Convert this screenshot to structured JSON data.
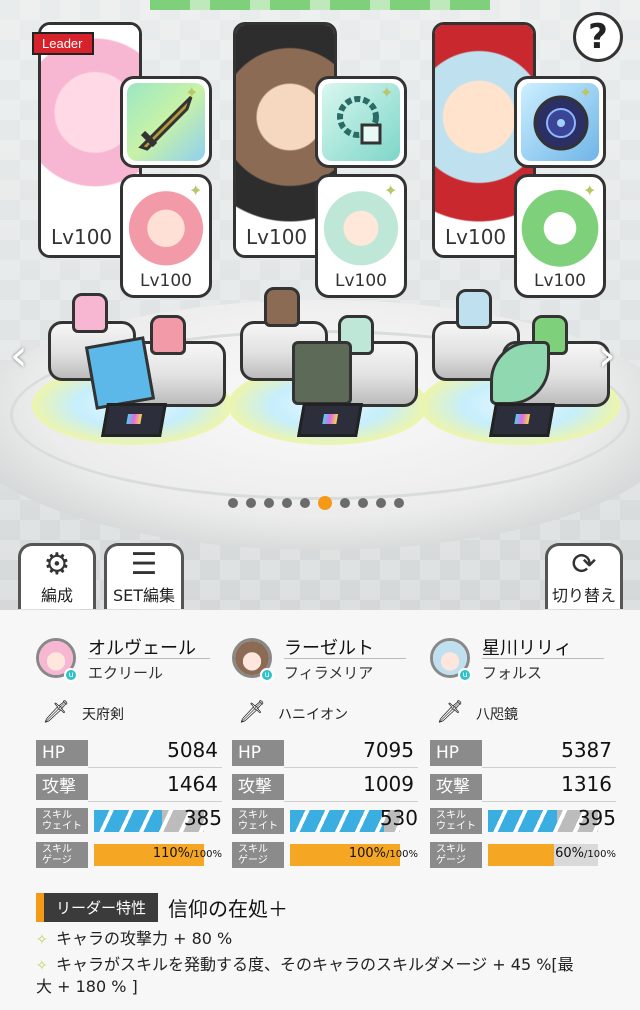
{
  "help": {
    "label": "?"
  },
  "leader_tag": "Leader",
  "party": [
    {
      "level": "Lv100",
      "support_level": "Lv100",
      "weapon_icon": "sword-icon",
      "colors": {
        "portrait": "#f7b6d2",
        "weapon": "#a8e6a1",
        "support": "#f29aa8"
      }
    },
    {
      "level": "Lv100",
      "support_level": "Lv100",
      "weapon_icon": "bracelet-icon",
      "colors": {
        "portrait": "#8c6b54",
        "weapon": "#7dd6c8",
        "support": "#bfe7d8"
      }
    },
    {
      "level": "Lv100",
      "support_level": "Lv100",
      "weapon_icon": "mirror-icon",
      "colors": {
        "portrait": "#bfe1ef",
        "weapon": "#6fb5e8",
        "support": "#7fd07a"
      }
    }
  ],
  "pagination": {
    "total": 10,
    "active": 6
  },
  "buttons": {
    "formation": "編成",
    "set_edit": "SET編集",
    "switch": "切り替え"
  },
  "characters": [
    {
      "name": "オルヴェール",
      "subtitle": "エクリール",
      "weapon": "天府剣",
      "hp_label": "HP",
      "hp": "5084",
      "atk_label": "攻撃",
      "atk": "1464",
      "wait_label_1": "スキル",
      "wait_label_2": "ウェイト",
      "wait": "385",
      "wait_fill": 0.62,
      "gauge_label_1": "スキル",
      "gauge_label_2": "ゲージ",
      "gauge_current": "110%",
      "gauge_max": "/100%",
      "gauge_fill": 1.0
    },
    {
      "name": "ラーゼルト",
      "subtitle": "フィラメリア",
      "weapon": "ハニイオン",
      "hp_label": "HP",
      "hp": "7095",
      "atk_label": "攻撃",
      "atk": "1009",
      "wait_label_1": "スキル",
      "wait_label_2": "ウェイト",
      "wait": "530",
      "wait_fill": 0.85,
      "gauge_label_1": "スキル",
      "gauge_label_2": "ゲージ",
      "gauge_current": "100%",
      "gauge_max": "/100%",
      "gauge_fill": 1.0
    },
    {
      "name": "星川リリィ",
      "subtitle": "フォルス",
      "weapon": "八咫鏡",
      "hp_label": "HP",
      "hp": "5387",
      "atk_label": "攻撃",
      "atk": "1316",
      "wait_label_1": "スキル",
      "wait_label_2": "ウェイト",
      "wait": "395",
      "wait_fill": 0.63,
      "gauge_label_1": "スキル",
      "gauge_label_2": "ゲージ",
      "gauge_current": "60%",
      "gauge_max": "/100%",
      "gauge_fill": 0.6
    }
  ],
  "leader_trait": {
    "label": "リーダー特性",
    "name": "信仰の在処＋",
    "lines": [
      "キャラの攻撃力 + 80 %",
      "キャラがスキルを発動する度、そのキャラのスキルダメージ + 45 %[最",
      "大 + 180 % ]"
    ]
  }
}
